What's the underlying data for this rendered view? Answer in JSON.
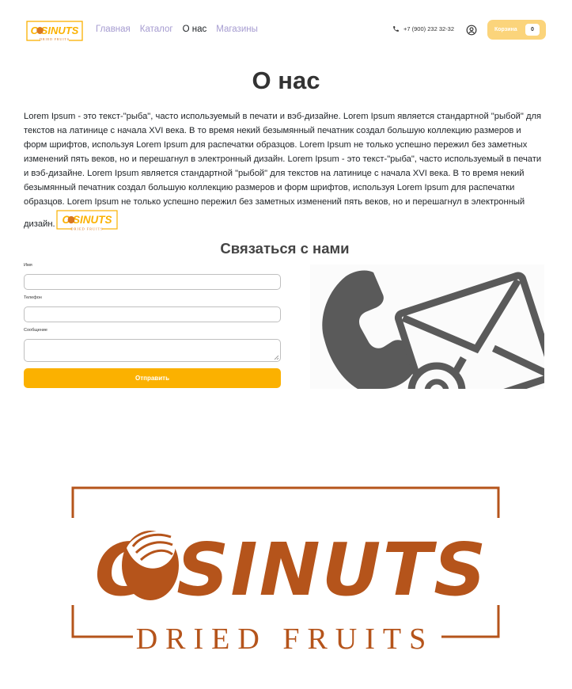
{
  "header": {
    "logo": {
      "word": "CASINUTS",
      "tagline": "DRIED FRUITS",
      "brand_color": "#fbb100"
    },
    "nav": [
      {
        "label": "Главная",
        "active": false
      },
      {
        "label": "Каталог",
        "active": false
      },
      {
        "label": "О нас",
        "active": true
      },
      {
        "label": "Магазины",
        "active": false
      }
    ],
    "phone": {
      "icon": "phone-icon",
      "number": "+7 (900) 232 32-32"
    },
    "account_icon": "user-circle-icon",
    "cart": {
      "label": "Корзина",
      "count": "0",
      "color": "#fbd47b"
    }
  },
  "page": {
    "title": "О нас",
    "about_text": "Lorem Ipsum - это текст-\"рыба\", часто используемый в печати и вэб-дизайне. Lorem Ipsum является стандартной \"рыбой\" для текстов на латинице с начала XVI века. В то время некий безымянный печатник создал большую коллекцию размеров и форм шрифтов, используя Lorem Ipsum для распечатки образцов. Lorem Ipsum не только успешно пережил без заметных изменений пять веков, но и перешагнул в электронный дизайн. Lorem Ipsum - это текст-\"рыба\", часто используемый в печати и вэб-дизайне. Lorem Ipsum является стандартной \"рыбой\" для текстов на латинице с начала XVI века. В то время некий безымянный печатник создал большую коллекцию размеров и форм шрифтов, используя Lorem Ipsum для распечатки образцов. Lorem Ipsum не только успешно пережил без заметных изменений пять веков, но и перешагнул в электронный дизайн."
  },
  "contact": {
    "title": "Связаться с нами",
    "fields": {
      "name_label": "Имя",
      "phone_label": "Телефон",
      "message_label": "Сообщение"
    },
    "submit_label": "Отправить",
    "submit_color": "#fbb100",
    "image_icon": "phone-mail-icon"
  },
  "footer_logo": {
    "word": "CASINUTS",
    "tagline": "DRIED FRUITS",
    "color": "#b5541b"
  }
}
